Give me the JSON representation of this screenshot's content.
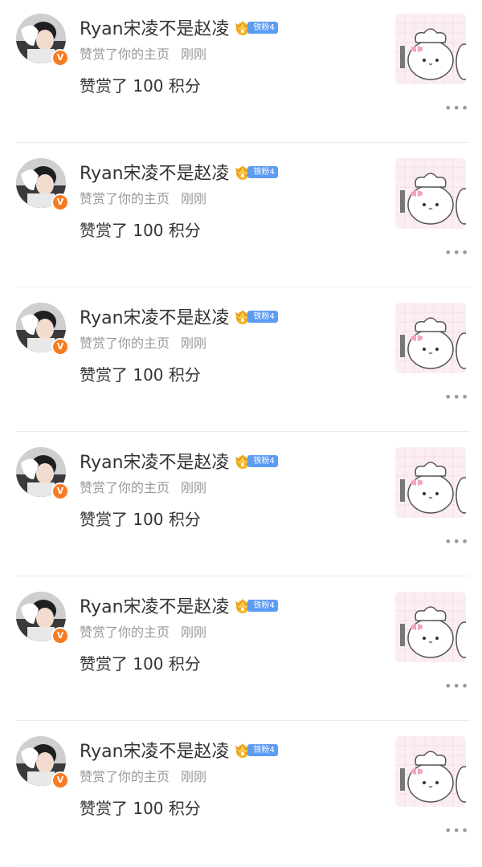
{
  "notifications": [
    {
      "user_name": "Ryan宋凌不是赵凌",
      "fan_badge": "铁粉4",
      "action": "赞赏了你的主页",
      "time": "刚刚",
      "content": "赞赏了 100 积分",
      "more": "•••"
    },
    {
      "user_name": "Ryan宋凌不是赵凌",
      "fan_badge": "铁粉4",
      "action": "赞赏了你的主页",
      "time": "刚刚",
      "content": "赞赏了 100 积分",
      "more": "•••"
    },
    {
      "user_name": "Ryan宋凌不是赵凌",
      "fan_badge": "铁粉4",
      "action": "赞赏了你的主页",
      "time": "刚刚",
      "content": "赞赏了 100 积分",
      "more": "•••"
    },
    {
      "user_name": "Ryan宋凌不是赵凌",
      "fan_badge": "铁粉4",
      "action": "赞赏了你的主页",
      "time": "刚刚",
      "content": "赞赏了 100 积分",
      "more": "•••"
    },
    {
      "user_name": "Ryan宋凌不是赵凌",
      "fan_badge": "铁粉4",
      "action": "赞赏了你的主页",
      "time": "刚刚",
      "content": "赞赏了 100 积分",
      "more": "•••"
    },
    {
      "user_name": "Ryan宋凌不是赵凌",
      "fan_badge": "铁粉4",
      "action": "赞赏了你的主页",
      "time": "刚刚",
      "content": "赞赏了 100 积分",
      "more": "•••"
    }
  ],
  "verified_badge": "V",
  "colors": {
    "verified": "#f77b23",
    "fan_badge": "#5d9cf5",
    "crown": "#f5b324"
  }
}
